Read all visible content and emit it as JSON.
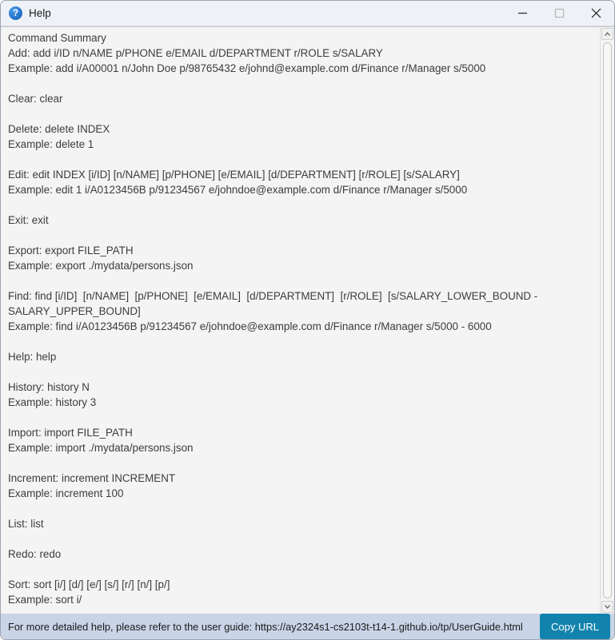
{
  "window": {
    "title": "Help",
    "icon": "question-circle-icon",
    "controls": {
      "minimize": "minimize-icon",
      "maximize": "maximize-icon",
      "close": "close-icon"
    }
  },
  "help": {
    "lines": [
      "Command Summary",
      "Add: add i/ID n/NAME p/PHONE e/EMAIL d/DEPARTMENT r/ROLE s/SALARY",
      "Example: add i/A00001 n/John Doe p/98765432 e/johnd@example.com d/Finance r/Manager s/5000",
      "",
      "Clear: clear",
      "",
      "Delete: delete INDEX",
      "Example: delete 1",
      "",
      "Edit: edit INDEX [i/ID] [n/NAME] [p/PHONE] [e/EMAIL] [d/DEPARTMENT] [r/ROLE] [s/SALARY]",
      "Example: edit 1 i/A0123456B p/91234567 e/johndoe@example.com d/Finance r/Manager s/5000",
      "",
      "Exit: exit",
      "",
      "Export: export FILE_PATH",
      "Example: export ./mydata/persons.json",
      "",
      "Find: find [i/ID]  [n/NAME]  [p/PHONE]  [e/EMAIL]  [d/DEPARTMENT]  [r/ROLE]  [s/SALARY_LOWER_BOUND - SALARY_UPPER_BOUND]",
      "Example: find i/A0123456B p/91234567 e/johndoe@example.com d/Finance r/Manager s/5000 - 6000",
      "",
      "Help: help",
      "",
      "History: history N",
      "Example: history 3",
      "",
      "Import: import FILE_PATH",
      "Example: import ./mydata/persons.json",
      "",
      "Increment: increment INCREMENT",
      "Example: increment 100",
      "",
      "List: list",
      "",
      "Redo: redo",
      "",
      "Sort: sort [i/] [d/] [e/] [s/] [r/] [n/] [p/]",
      "Example: sort i/"
    ]
  },
  "scrollbar": {
    "up_arrow": "chevron-up-icon",
    "down_arrow": "chevron-down-icon"
  },
  "status": {
    "message": "For more detailed help, please refer to the user guide: https://ay2324s1-cs2103t-t14-1.github.io/tp/UserGuide.html",
    "copy_button_label": "Copy URL"
  },
  "colors": {
    "titlebar": "#eef2f6",
    "content_background": "#f4f4f4",
    "statusbar": "#c9d4e7",
    "accent_button": "#1283ad",
    "help_icon": "#1f6fc4",
    "text": "#3c3c3c"
  }
}
